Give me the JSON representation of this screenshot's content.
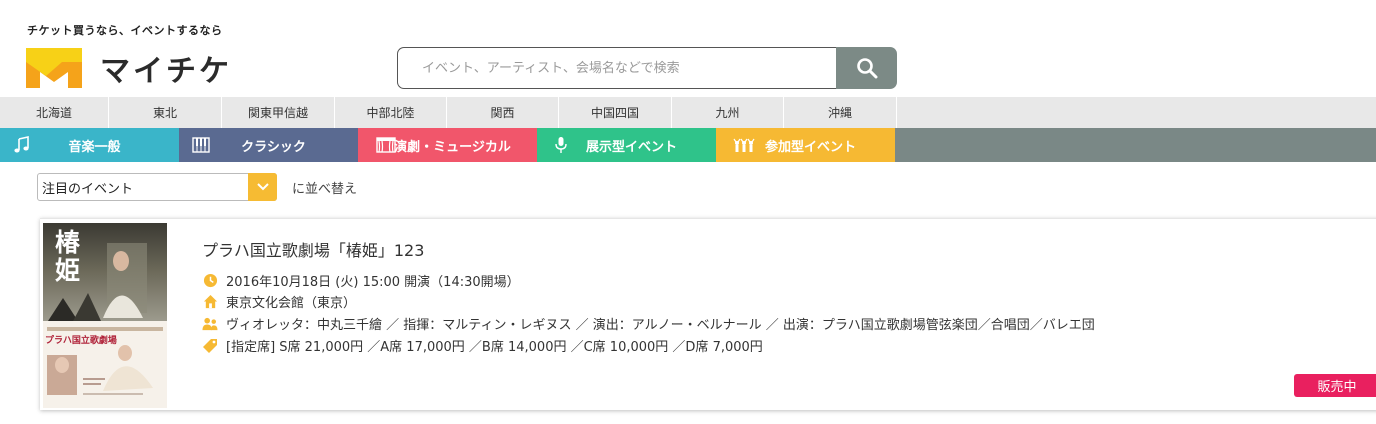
{
  "header": {
    "tagline": "チケット買うなら、イベントするなら",
    "logo_text": "マイチケ",
    "logo_colors": {
      "yellow": "#f7d117",
      "amber": "#f5a31a"
    }
  },
  "search": {
    "placeholder": "イベント、アーティスト、会場名などで検索",
    "button_icon": "search-icon",
    "button_color": "#7c8a86"
  },
  "regions": [
    {
      "label": "北海道"
    },
    {
      "label": "東北"
    },
    {
      "label": "関東甲信越"
    },
    {
      "label": "中部北陸"
    },
    {
      "label": "関西"
    },
    {
      "label": "中国四国"
    },
    {
      "label": "九州"
    },
    {
      "label": "沖縄"
    }
  ],
  "categories": [
    {
      "label": "音楽一般",
      "icon": "music-note-icon",
      "color": "#3ab5c9"
    },
    {
      "label": "クラシック",
      "icon": "piano-icon",
      "color": "#5a6a91"
    },
    {
      "label": "演劇・ミュージカル",
      "icon": "theater-stage-icon",
      "color": "#f1566b"
    },
    {
      "label": "展示型イベント",
      "icon": "microphone-icon",
      "color": "#2fc38a"
    },
    {
      "label": "参加型イベント",
      "icon": "people-cheer-icon",
      "color": "#f6b933"
    }
  ],
  "sort": {
    "selected": "注目のイベント",
    "suffix": "に並べ替え"
  },
  "event": {
    "title": "プラハ国立歌劇場「椿姫」123",
    "datetime": "2016年10月18日 (火) 15:00 開演（14:30開場）",
    "venue": "東京文化会館（東京）",
    "cast": "ヴィオレッタ：中丸三千繪 ／ 指揮：マルティン・レギヌス ／ 演出：アルノー・ベルナール ／ 出演：プラハ国立歌劇場管弦楽団／合唱団／バレエ団",
    "prices": "[指定席] S席 21,000円 ／A席 17,000円 ／B席 14,000円 ／C席 10,000円 ／D席 7,000円",
    "status": "販売中",
    "status_color": "#e9205f",
    "icon_color": "#f6b933",
    "poster": {
      "title_kanji": "椿姫",
      "subtitle": "プラハ国立歌劇場"
    }
  }
}
